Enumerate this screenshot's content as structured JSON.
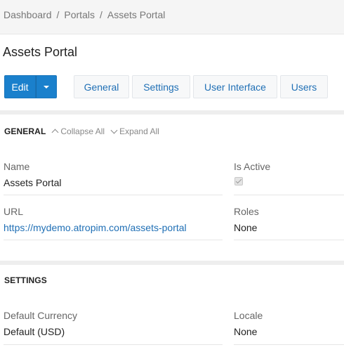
{
  "breadcrumb": {
    "items": [
      "Dashboard",
      "Portals",
      "Assets Portal"
    ],
    "separator": "/"
  },
  "page": {
    "title": "Assets Portal"
  },
  "toolbar": {
    "edit_label": "Edit",
    "tabs": [
      "General",
      "Settings",
      "User Interface",
      "Users"
    ]
  },
  "general_panel": {
    "title": "GENERAL",
    "collapse_all": "Collapse All",
    "expand_all": "Expand All",
    "fields": {
      "name_label": "Name",
      "name_value": "Assets Portal",
      "is_active_label": "Is Active",
      "is_active_checked": true,
      "url_label": "URL",
      "url_value": "https://mydemo.atropim.com/assets-portal",
      "roles_label": "Roles",
      "roles_value": "None"
    }
  },
  "settings_panel": {
    "title": "SETTINGS",
    "fields": {
      "currency_label": "Default Currency",
      "currency_value": "Default (USD)",
      "locale_label": "Locale",
      "locale_value": "None"
    }
  },
  "colors": {
    "primary": "#1a80cc",
    "link": "#1f6fb5",
    "breadcrumb_bg": "#f5f5f5"
  },
  "icons": {
    "caret": "caret-down-icon",
    "collapse": "chevron-up-icon",
    "expand": "chevron-down-icon",
    "checkbox": "checkbox-checked-icon"
  }
}
